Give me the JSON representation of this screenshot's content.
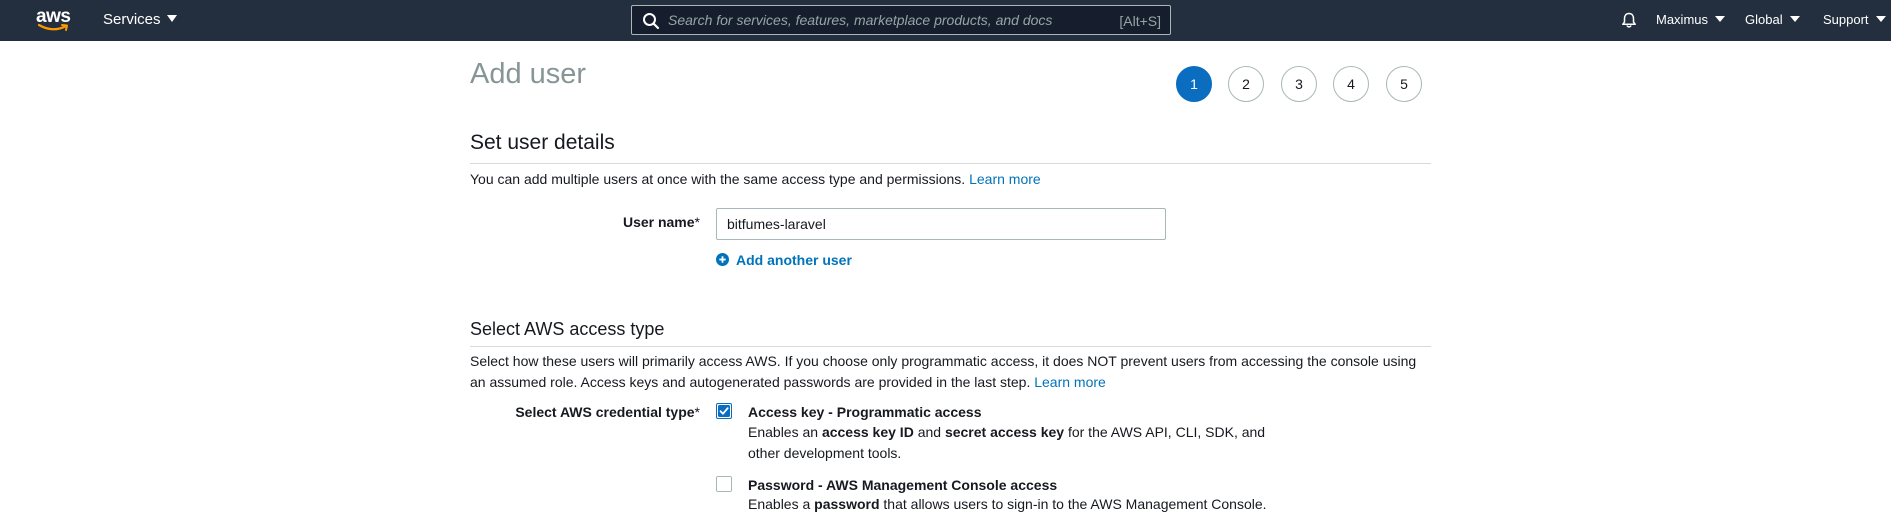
{
  "topnav": {
    "logo_text": "aws",
    "services_label": "Services",
    "search": {
      "placeholder": "Search for services, features, marketplace products, and docs",
      "shortcut": "[Alt+S]"
    },
    "bell_icon": "bell-icon",
    "account_label": "Maximus",
    "region_label": "Global",
    "support_label": "Support"
  },
  "page": {
    "title": "Add user",
    "steps": [
      "1",
      "2",
      "3",
      "4",
      "5"
    ],
    "active_step": "1"
  },
  "user_details": {
    "title": "Set user details",
    "description": "You can add multiple users at once with the same access type and permissions.",
    "learn_more": "Learn more",
    "user_name_label": "User name",
    "required_mark": "*",
    "user_name_value": "bitfumes-laravel",
    "add_another_label": "Add another user"
  },
  "access_type": {
    "title": "Select AWS access type",
    "description": "Select how these users will primarily access AWS. If you choose only programmatic access, it does NOT prevent users from accessing the console using an assumed role. Access keys and autogenerated passwords are provided in the last step.",
    "learn_more": "Learn more",
    "credential_label": "Select AWS credential type",
    "required_mark": "*",
    "options": [
      {
        "title": "Access key - Programmatic access",
        "desc_parts": [
          "Enables an ",
          "access key ID",
          " and ",
          "secret access key",
          " for the AWS API, CLI, SDK, and other development tools."
        ],
        "checked": true
      },
      {
        "title": "Password - AWS Management Console access",
        "desc_parts": [
          "Enables a ",
          "password",
          " that allows users to sign-in to the AWS Management Console."
        ],
        "checked": false
      }
    ]
  },
  "colors": {
    "nav_bg": "#232f3e",
    "accent": "#0a6dbf",
    "link": "#0073bb",
    "muted_title": "#879596"
  }
}
